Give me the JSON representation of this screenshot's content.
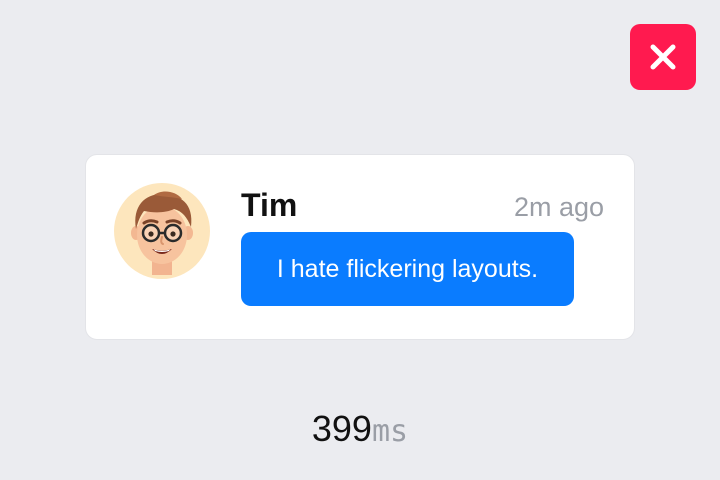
{
  "close_button": {
    "icon": "close-icon",
    "color": "#ff1a4f"
  },
  "message": {
    "sender": "Tim",
    "time": "2m ago",
    "text": "I hate flickering layouts.",
    "avatar_icon": "memoji-avatar",
    "bubble_color": "#0a7cff"
  },
  "timer": {
    "value": "399",
    "unit": "ms"
  }
}
